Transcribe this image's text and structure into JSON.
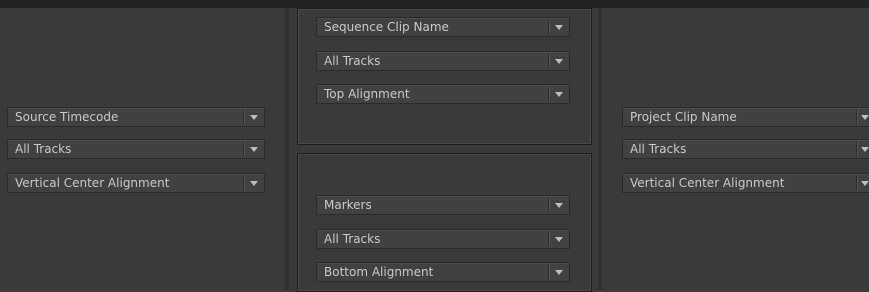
{
  "left_panel": {
    "dropdowns": [
      {
        "value": "Source Timecode"
      },
      {
        "value": "All Tracks"
      },
      {
        "value": "Vertical Center Alignment"
      }
    ]
  },
  "center_top_panel": {
    "dropdowns": [
      {
        "value": "Sequence Clip Name"
      },
      {
        "value": "All Tracks"
      },
      {
        "value": "Top Alignment"
      }
    ]
  },
  "center_bottom_panel": {
    "dropdowns": [
      {
        "value": "Markers"
      },
      {
        "value": "All Tracks"
      },
      {
        "value": "Bottom Alignment"
      }
    ]
  },
  "right_panel": {
    "dropdowns": [
      {
        "value": "Project Clip Name"
      },
      {
        "value": "All Tracks"
      },
      {
        "value": "Vertical Center Alignment"
      }
    ]
  },
  "icons": {
    "dropdown_arrow": "chevron-down-icon"
  },
  "colors": {
    "background": "#3a3a3a",
    "field": "#414141",
    "text": "#c9c9c9",
    "border": "#1e1e1e"
  }
}
